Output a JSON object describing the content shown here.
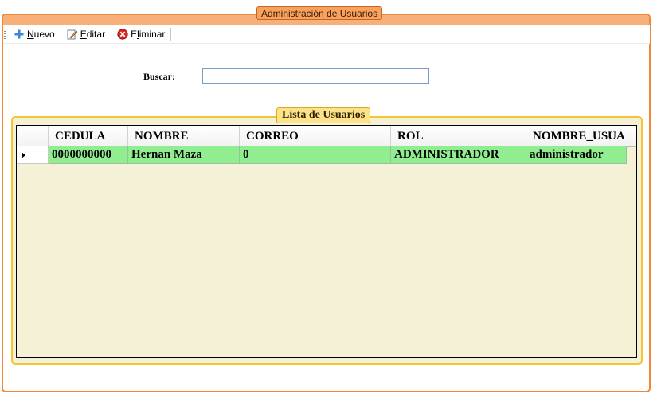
{
  "window": {
    "title": "Administración de Usuarios"
  },
  "toolbar": {
    "items": [
      {
        "label_prefix": "",
        "label_underlined": "N",
        "label_rest": "uevo",
        "icon": "plus-icon"
      },
      {
        "label_prefix": "",
        "label_underlined": "E",
        "label_rest": "ditar",
        "icon": "edit-pencil-icon"
      },
      {
        "label_prefix": "E",
        "label_underlined": "l",
        "label_rest": "iminar",
        "icon": "delete-icon"
      }
    ]
  },
  "search": {
    "label": "Buscar:",
    "value": ""
  },
  "group": {
    "title": "Lista de Usuarios"
  },
  "grid": {
    "columns": [
      "CEDULA",
      "NOMBRE",
      "CORREO",
      "ROL",
      "NOMBRE_USUA"
    ],
    "rows": [
      [
        "0000000000",
        "Hernan Maza",
        "0",
        "ADMINISTRADOR",
        "administrador"
      ]
    ]
  },
  "colors": {
    "outer_border": "#f0883a",
    "outer_title_bg": "#f7a25f",
    "inner_border": "#f3c433",
    "inner_bg": "#f5f1d6",
    "selected_row": "#90ee90"
  }
}
